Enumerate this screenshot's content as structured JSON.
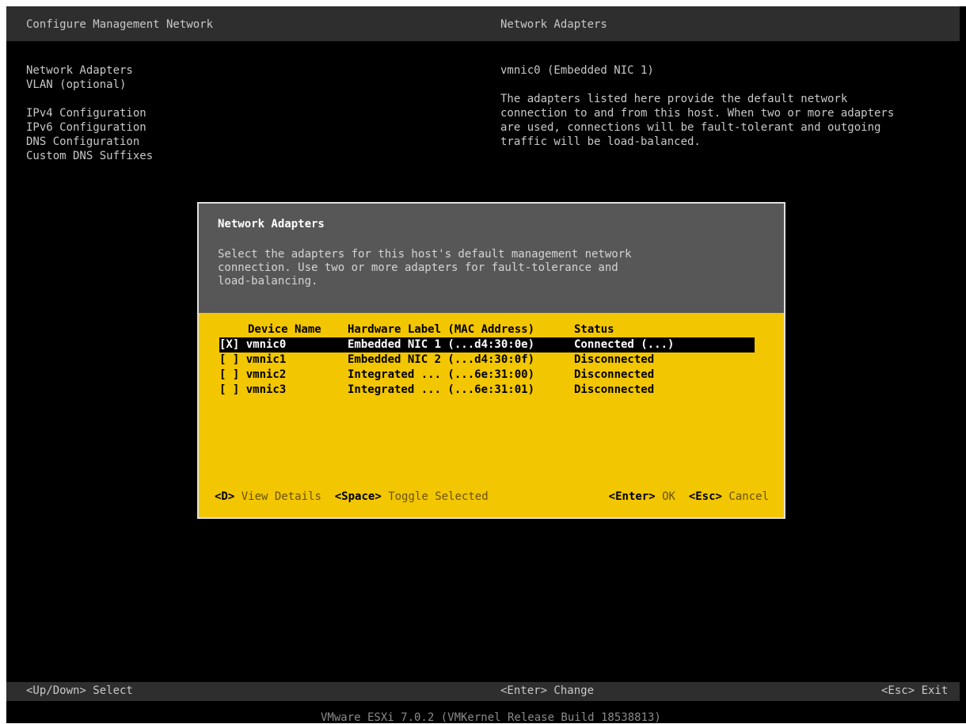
{
  "header": {
    "left_title": "Configure Management Network",
    "right_title": "Network Adapters"
  },
  "menu": {
    "items": [
      "Network Adapters",
      "VLAN (optional)",
      "IPv4 Configuration",
      "IPv6 Configuration",
      "DNS Configuration",
      "Custom DNS Suffixes"
    ]
  },
  "info": {
    "current": "vmnic0 (Embedded NIC 1)",
    "lines": [
      "The adapters listed here provide the default network",
      "connection to and from this host. When two or more adapters",
      "are used, connections will be fault-tolerant and outgoing",
      "traffic will be load-balanced."
    ]
  },
  "dialog": {
    "title": "Network Adapters",
    "description": "Select the adapters for this host's default management network\nconnection. Use two or more adapters for fault-tolerance and\nload-balancing.",
    "columns": [
      "Device Name",
      "Hardware Label (MAC Address)",
      "Status"
    ],
    "rows": [
      {
        "device": "[X] vmnic0",
        "label": "Embedded NIC 1 (...d4:30:0e)",
        "status": "Connected (...)"
      },
      {
        "device": "[ ] vmnic1",
        "label": "Embedded NIC 2 (...d4:30:0f)",
        "status": "Disconnected"
      },
      {
        "device": "[ ] vmnic2",
        "label": "Integrated ... (...6e:31:00)",
        "status": "Disconnected"
      },
      {
        "device": "[ ] vmnic3",
        "label": "Integrated ... (...6e:31:01)",
        "status": "Disconnected"
      }
    ],
    "keys": {
      "details_key": "<D>",
      "details_label": "View Details",
      "toggle_key": "<Space>",
      "toggle_label": "Toggle Selected",
      "ok_key": "<Enter>",
      "ok_label": "OK",
      "cancel_key": "<Esc>",
      "cancel_label": "Cancel"
    }
  },
  "footer": {
    "left": "<Up/Down> Select",
    "mid": "<Enter> Change",
    "right": "<Esc> Exit",
    "version": "VMware ESXi 7.0.2 (VMKernel Release Build 18538813)"
  },
  "colors": {
    "dialog_body": "#f2c600",
    "dialog_head": "#575757",
    "background": "#000000"
  }
}
